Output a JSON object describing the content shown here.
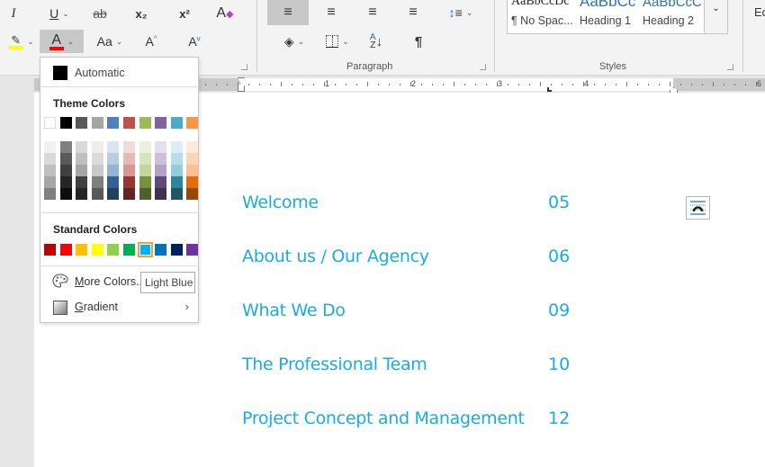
{
  "ribbon": {
    "font_group": {
      "italic": "I",
      "underline": "U",
      "strikethrough": "ab",
      "subscript": "x₂",
      "superscript": "x²",
      "change_case": "Aa",
      "grow_font": "A",
      "shrink_font": "A",
      "font_color": "A",
      "highlight_color": "#ffff00",
      "font_color_value": "#ff0000"
    },
    "paragraph_group": {
      "label": "Paragraph",
      "pilcrow": "¶",
      "sort": "A Z"
    },
    "styles_group": {
      "label": "Styles",
      "items": [
        {
          "preview": "AaBbCcDc",
          "name": "¶ No Spac..."
        },
        {
          "preview": "AaBbCc",
          "name": "Heading 1"
        },
        {
          "preview": "AaBbCcC",
          "name": "Heading 2"
        }
      ]
    },
    "editing_label": "Ed"
  },
  "ruler": {
    "numbers": [
      "1",
      "2",
      "3",
      "4",
      "6"
    ],
    "right_indent_marker": "3"
  },
  "font_color_menu": {
    "automatic_label": "Automatic",
    "theme_colors_heading": "Theme Colors",
    "theme_colors": [
      "#ffffff",
      "#000000",
      "#595959",
      "#a5a5a5",
      "#4f81bd",
      "#c0504d",
      "#9bbb59",
      "#8064a2",
      "#4bacc6",
      "#f79646"
    ],
    "theme_shades": [
      [
        "#f2f2f2",
        "#d9d9d9",
        "#bfbfbf",
        "#a6a6a6",
        "#808080"
      ],
      [
        "#808080",
        "#595959",
        "#404040",
        "#262626",
        "#0d0d0d"
      ],
      [
        "#d9d9d9",
        "#bfbfbf",
        "#a6a6a6",
        "#404040",
        "#262626"
      ],
      [
        "#ededed",
        "#dbdbdb",
        "#c9c9c9",
        "#7f7f7f",
        "#595959"
      ],
      [
        "#dbe5f1",
        "#b8cce4",
        "#95b3d7",
        "#366092",
        "#244061"
      ],
      [
        "#f2dcdb",
        "#e6b9b8",
        "#d99694",
        "#953734",
        "#632423"
      ],
      [
        "#ebf1dd",
        "#d7e3bc",
        "#c3d69b",
        "#76923c",
        "#4f6128"
      ],
      [
        "#e5e0ec",
        "#ccc1d9",
        "#b2a2c7",
        "#5f497a",
        "#3f3151"
      ],
      [
        "#dbeef3",
        "#b7dde8",
        "#92cddc",
        "#31859b",
        "#205867"
      ],
      [
        "#fdeada",
        "#fbd5b5",
        "#fac08f",
        "#e36c09",
        "#974806"
      ]
    ],
    "standard_colors_heading": "Standard Colors",
    "standard_colors": [
      "#c00000",
      "#ff0000",
      "#ffc000",
      "#ffff00",
      "#92d050",
      "#00b050",
      "#00b0f0",
      "#0070c0",
      "#002060",
      "#7030a0"
    ],
    "selected_standard_index": 6,
    "more_colors_label": "More Colors...",
    "more_colors_mnemonic": "M",
    "gradient_label": "Gradient",
    "gradient_mnemonic": "G",
    "tooltip": "Light Blue"
  },
  "document": {
    "accent_color": "#1aabe6",
    "toc": [
      {
        "title": "Welcome",
        "page": "05"
      },
      {
        "title": "About us / Our Agency",
        "page": "06"
      },
      {
        "title": "What We Do",
        "page": "09"
      },
      {
        "title": "The Professional Team",
        "page": "10"
      },
      {
        "title": "Project Concept and Management",
        "page": "12"
      }
    ]
  }
}
